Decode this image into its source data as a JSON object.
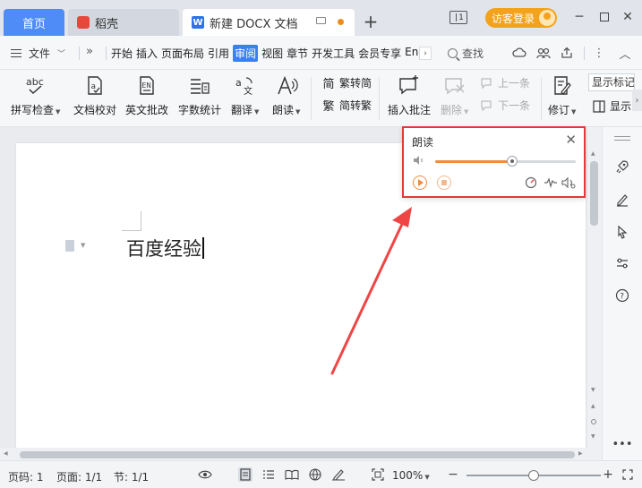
{
  "tabs": {
    "home": "首页",
    "daoke": "稻壳",
    "doc": "新建 DOCX 文档"
  },
  "titlebar": {
    "workspace_num": "1",
    "login_label": "访客登录"
  },
  "menu": {
    "file_label": "文件",
    "items": [
      "开始",
      "插入",
      "页面布局",
      "引用",
      "审阅",
      "视图",
      "章节",
      "开发工具",
      "会员专享",
      "En"
    ],
    "active_item": "审阅",
    "search_label": "查找"
  },
  "ribbon": {
    "spell_check": "拼写检查",
    "doc_proofread": "文档校对",
    "en_review": "英文批改",
    "word_count": "字数统计",
    "translate": "翻译",
    "read_aloud": "朗读",
    "trad_to_simp": "繁转简",
    "simp_to_trad": "简转繁",
    "insert_comment": "插入批注",
    "delete": "删除",
    "prev_item": "上一条",
    "next_item": "下一条",
    "revise": "修订",
    "show_mark": "显示标记",
    "display": "显示"
  },
  "document": {
    "body_text": "百度经验"
  },
  "read_panel": {
    "title": "朗读",
    "volume_percent": 55
  },
  "status": {
    "page_no": "页码: 1",
    "pages": "页面: 1/1",
    "section": "节: 1/1",
    "zoom": "100%",
    "zoom_percent": 50
  },
  "colors": {
    "accent": "#3b7ff0",
    "highlight": "#e23a3a",
    "orange": "#f08c3c",
    "login": "#f3a21b"
  }
}
